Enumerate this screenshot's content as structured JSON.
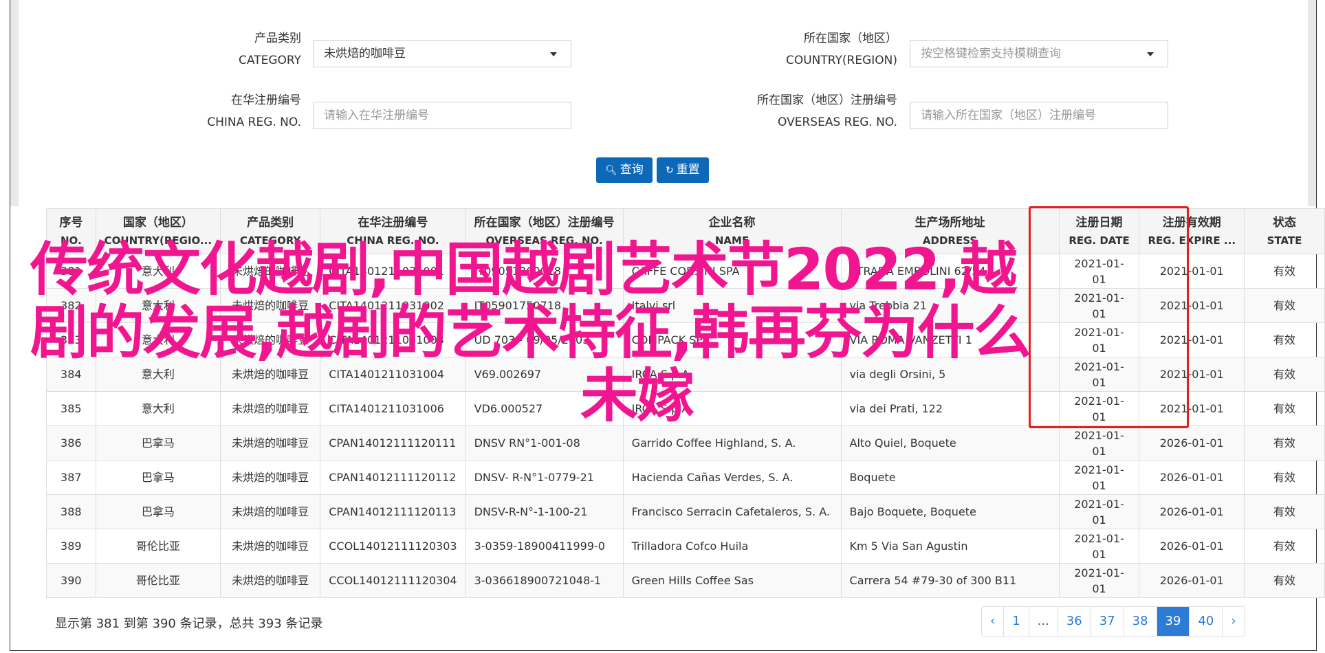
{
  "form": {
    "category": {
      "label_cn": "产品类别",
      "label_en": "CATEGORY",
      "value": "未烘焙的咖啡豆"
    },
    "country": {
      "label_cn": "所在国家（地区）",
      "label_en": "COUNTRY(REGION)",
      "placeholder": "按空格键检索支持模糊查询"
    },
    "china_reg": {
      "label_cn": "在华注册编号",
      "label_en": "CHINA REG. NO.",
      "placeholder": "请输入在华注册编号"
    },
    "overseas_reg": {
      "label_cn": "所在国家（地区）注册编号",
      "label_en": "OVERSEAS REG. NO.",
      "placeholder": "请输入所在国家（地区）注册编号"
    },
    "search_button": "查询",
    "reset_button": "重置"
  },
  "table": {
    "headers": [
      {
        "cn": "序号",
        "en": "NO."
      },
      {
        "cn": "国家（地区）",
        "en": "COUNTRY(REGIO..."
      },
      {
        "cn": "产品类别",
        "en": "CATEGORY"
      },
      {
        "cn": "在华注册编号",
        "en": "CHINA REG. NO."
      },
      {
        "cn": "所在国家（地区）注册编号",
        "en": "OVERSEAS REG. NO."
      },
      {
        "cn": "企业名称",
        "en": "NAME"
      },
      {
        "cn": "生产场所地址",
        "en": "ADDRESS"
      },
      {
        "cn": "注册日期",
        "en": "REG. DATE"
      },
      {
        "cn": "注册有效期",
        "en": "REG. EXPIRE ..."
      },
      {
        "cn": "状态",
        "en": "STATE"
      }
    ],
    "rows": [
      {
        "no": "381",
        "country": "意大利",
        "category": "未烘焙的咖啡豆",
        "china_reg": "CITA1401211031001",
        "overseas_reg": "IT09051360018",
        "name": "CAFFE CORSINI SPA",
        "address": "STRADA EMBOLINI 62/54",
        "reg_date": "2021-01-01",
        "expire": "2021-01-01",
        "state": "有效"
      },
      {
        "no": "382",
        "country": "意大利",
        "category": "未烘焙的咖啡豆",
        "china_reg": "CITA1401211031002",
        "overseas_reg": "IT05901750718",
        "name": "Italvi srl",
        "address": "via Trebbia 21",
        "reg_date": "2021-01-01",
        "expire": "2021-01-01",
        "state": "有效"
      },
      {
        "no": "383",
        "country": "意大利",
        "category": "未烘焙的咖啡豆",
        "china_reg": "CITA1401211031003",
        "overseas_reg": "UD 703 - 09/05/2003",
        "name": "COMPACK SPA",
        "address": "VIA ROMA VANZETTI 1",
        "reg_date": "2021-01-01",
        "expire": "2021-01-01",
        "state": "有效"
      },
      {
        "no": "384",
        "country": "意大利",
        "category": "未烘焙的咖啡豆",
        "china_reg": "CITA1401211031004",
        "overseas_reg": "V69.002697",
        "name": "IRCA S.p.A.",
        "address": "via degli Orsini, 5",
        "reg_date": "2021-01-01",
        "expire": "2021-01-01",
        "state": "有效"
      },
      {
        "no": "385",
        "country": "意大利",
        "category": "未烘焙的咖啡豆",
        "china_reg": "CITA1401211031006",
        "overseas_reg": "VD6.000527",
        "name": "IRCA S.p.A.",
        "address": "via dei Prati, 122",
        "reg_date": "2021-01-01",
        "expire": "2021-01-01",
        "state": "有效"
      },
      {
        "no": "386",
        "country": "巴拿马",
        "category": "未烘焙的咖啡豆",
        "china_reg": "CPAN14012111120111",
        "overseas_reg": "DNSV RN°1-001-08",
        "name": "Garrido Coffee Highland, S. A.",
        "address": "Alto Quiel, Boquete",
        "reg_date": "2021-01-01",
        "expire": "2026-01-01",
        "state": "有效"
      },
      {
        "no": "387",
        "country": "巴拿马",
        "category": "未烘焙的咖啡豆",
        "china_reg": "CPAN14012111120112",
        "overseas_reg": "DNSV- R-N°1-0779-21",
        "name": "Hacienda Cañas Verdes, S. A.",
        "address": "Boquete",
        "reg_date": "2021-01-01",
        "expire": "2026-01-01",
        "state": "有效"
      },
      {
        "no": "388",
        "country": "巴拿马",
        "category": "未烘焙的咖啡豆",
        "china_reg": "CPAN14012111120113",
        "overseas_reg": "DNSV-R-N°-1-100-21",
        "name": "Francisco Serracin Cafetaleros, S. A.",
        "address": "Bajo Boquete, Boquete",
        "reg_date": "2021-01-01",
        "expire": "2026-01-01",
        "state": "有效"
      },
      {
        "no": "389",
        "country": "哥伦比亚",
        "category": "未烘焙的咖啡豆",
        "china_reg": "CCOL14012111120303",
        "overseas_reg": "3-0359-18900411999-0",
        "name": "Trilladora Cofco Huila",
        "address": "Km 5 Via San Agustin",
        "reg_date": "2021-01-01",
        "expire": "2026-01-01",
        "state": "有效"
      },
      {
        "no": "390",
        "country": "哥伦比亚",
        "category": "未烘焙的咖啡豆",
        "china_reg": "CCOL14012111120304",
        "overseas_reg": "3-036618900721048-1",
        "name": "Green Hills Coffee Sas",
        "address": "Carrera 54 #79-30 of 300 B11",
        "reg_date": "2021-01-01",
        "expire": "2026-01-01",
        "state": "有效"
      }
    ]
  },
  "footer": {
    "summary": "显示第 381 到第 390 条记录，总共 393 条记录"
  },
  "pagination": {
    "prev": "‹",
    "pages": [
      "1",
      "...",
      "36",
      "37",
      "38",
      "39",
      "40"
    ],
    "active": "39",
    "next": "›"
  },
  "overlay": {
    "line1": "传统文化越剧,中国越剧艺术节2022,越",
    "line2": "剧的发展,越剧的艺术特征,韩再芬为什么",
    "line3": "未嫁"
  },
  "colors": {
    "primary": "#0d68b8",
    "highlight_border": "#e3201f",
    "overlay_text": "#f1158f",
    "link": "#2c7bd6"
  }
}
